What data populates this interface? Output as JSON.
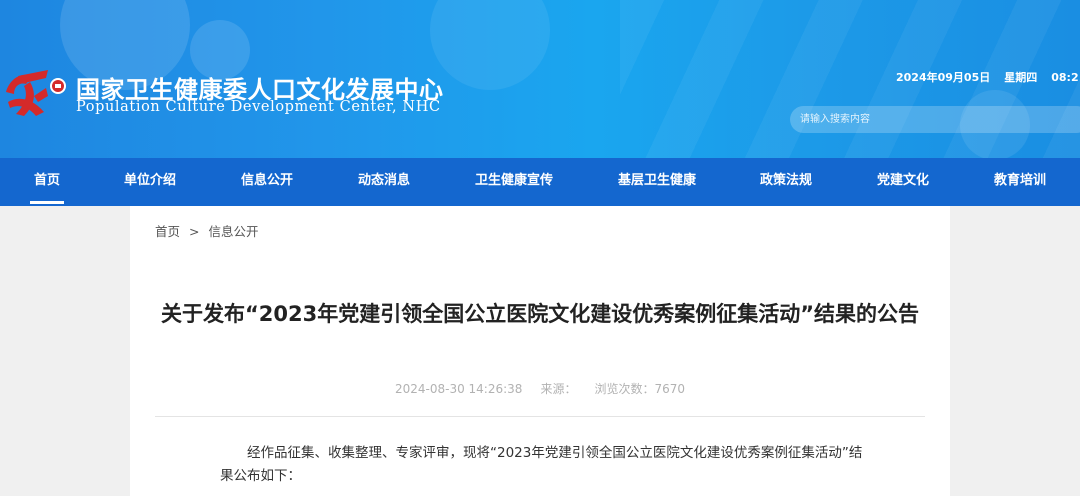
{
  "header": {
    "title_cn": "国家卫生健康委人口文化发展中心",
    "title_en": "Population Culture Development Center, NHC",
    "date": "2024年09月05日",
    "weekday": "星期四",
    "time": "08:2",
    "search_placeholder": "请输入搜索内容"
  },
  "nav": {
    "items": [
      {
        "label": "首页"
      },
      {
        "label": "单位介绍"
      },
      {
        "label": "信息公开"
      },
      {
        "label": "动态消息"
      },
      {
        "label": "卫生健康宣传"
      },
      {
        "label": "基层卫生健康"
      },
      {
        "label": "政策法规"
      },
      {
        "label": "党建文化"
      },
      {
        "label": "教育培训"
      }
    ],
    "active_index": 0
  },
  "breadcrumb": {
    "home": "首页",
    "separator": ">",
    "current": "信息公开"
  },
  "article": {
    "title": "关于发布“2023年党建引领全国公立医院文化建设优秀案例征集活动”结果的公告",
    "datetime": "2024-08-30 14:26:38",
    "source_label": "来源：",
    "views_label": "浏览次数：7670",
    "paragraph": "经作品征集、收集整理、专家评审，现将“2023年党建引领全国公立医院文化建设优秀案例征集活动”结果公布如下："
  },
  "colors": {
    "nav_bg": "#1467cf",
    "header_blue": "#1aa6ef",
    "logo_red": "#d42a2a"
  }
}
